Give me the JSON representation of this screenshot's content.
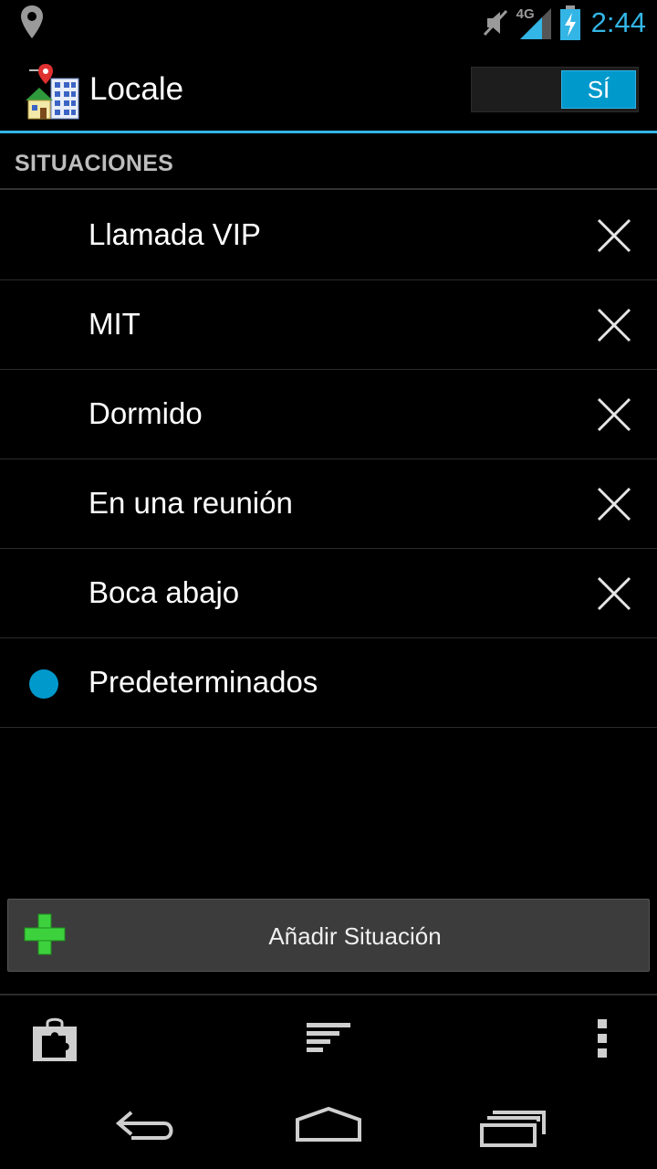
{
  "status_bar": {
    "time": "2:44",
    "network": "4G",
    "icons": [
      "location-icon",
      "mute-icon",
      "signal-icon",
      "battery-charging-icon"
    ]
  },
  "header": {
    "title": "Locale",
    "toggle_label": "SÍ",
    "toggle_on": true
  },
  "section": {
    "title": "SITUACIONES"
  },
  "situations": [
    {
      "label": "Llamada VIP",
      "deletable": true
    },
    {
      "label": "MIT",
      "deletable": true
    },
    {
      "label": "Dormido",
      "deletable": true
    },
    {
      "label": "En una reunión",
      "deletable": true
    },
    {
      "label": "Boca abajo",
      "deletable": true
    },
    {
      "label": "Predeterminados",
      "deletable": false,
      "active": true
    }
  ],
  "add_button": {
    "label": "Añadir Situación"
  },
  "bottom_bar": {
    "icons": [
      "plugin-store-icon",
      "sort-icon",
      "overflow-menu-icon"
    ]
  },
  "nav_bar": {
    "icons": [
      "back-icon",
      "home-icon",
      "recents-icon"
    ]
  },
  "colors": {
    "accent": "#33b5e5",
    "accent_dark": "#0099cc",
    "background": "#000000",
    "plus_green": "#2ecc40"
  }
}
